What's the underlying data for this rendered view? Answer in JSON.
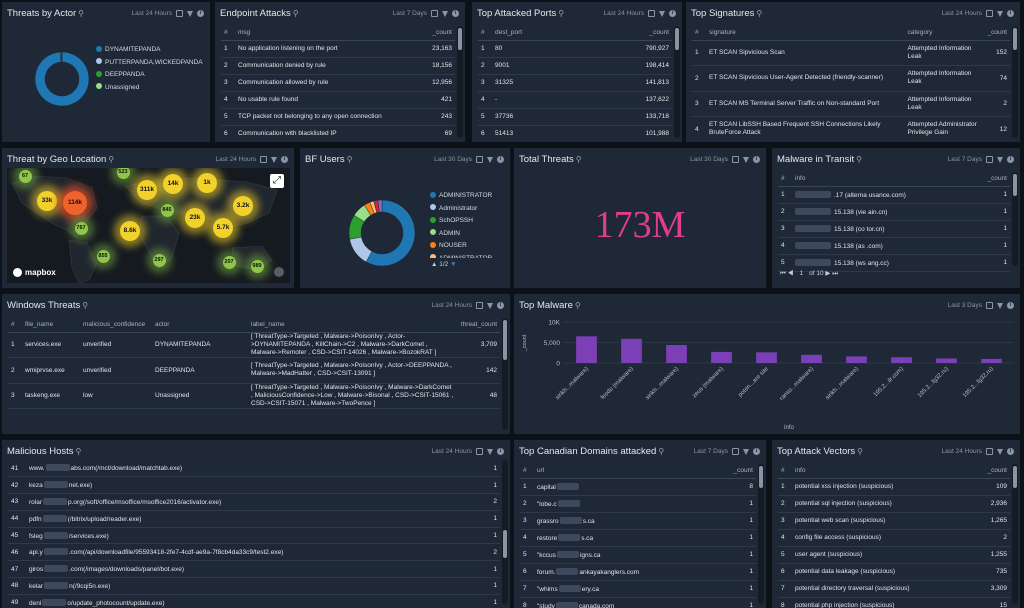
{
  "threats_by_actor": {
    "title": "Threats by Actor",
    "time": "Last 24 Hours",
    "legend": [
      {
        "label": "DYNAMITEPANDA",
        "color": "#1f77b4"
      },
      {
        "label": "PUTTERPANDA,WICKEDPANDA",
        "color": "#aec7e8"
      },
      {
        "label": "DEEPPANDA",
        "color": "#2ca02c"
      },
      {
        "label": "Unassigned",
        "color": "#98df8a"
      }
    ],
    "shares": [
      0.99,
      0.004,
      0.003,
      0.003
    ]
  },
  "endpoint_attacks": {
    "title": "Endpoint Attacks",
    "time": "Last 7 Days",
    "headers": [
      "#",
      "msg",
      "_count"
    ],
    "rows": [
      [
        "1",
        "No application listening on the port",
        "23,163"
      ],
      [
        "2",
        "Communication denied by rule",
        "18,156"
      ],
      [
        "3",
        "Communication allowed by rule",
        "12,956"
      ],
      [
        "4",
        "No usable rule found",
        "421"
      ],
      [
        "5",
        "TCP packet not belonging to any open connection",
        "243"
      ],
      [
        "6",
        "Communication with blacklisted IP",
        "69"
      ]
    ]
  },
  "top_attacked_ports": {
    "title": "Top Attacked Ports",
    "time": "Last 24 Hours",
    "headers": [
      "#",
      "dest_port",
      "_count"
    ],
    "rows": [
      [
        "1",
        "80",
        "790,927"
      ],
      [
        "2",
        "9001",
        "198,414"
      ],
      [
        "3",
        "31325",
        "141,813"
      ],
      [
        "4",
        "-",
        "137,622"
      ],
      [
        "5",
        "37736",
        "133,718"
      ],
      [
        "6",
        "51413",
        "101,988"
      ]
    ]
  },
  "top_signatures": {
    "title": "Top Signatures",
    "time": "Last 24 Hours",
    "headers": [
      "#",
      "signature",
      "category",
      "_count"
    ],
    "rows": [
      [
        "1",
        "ET SCAN Sipvicious Scan",
        "Attempted Information Leak",
        "152"
      ],
      [
        "2",
        "ET SCAN Sipvicious User-Agent Detected (friendly-scanner)",
        "Attempted Information Leak",
        "74"
      ],
      [
        "3",
        "ET SCAN MS Terminal Server Traffic on Non-standard Port",
        "Attempted Information Leak",
        "2"
      ],
      [
        "4",
        "ET SCAN LibSSH Based Frequent SSH Connections Likely BruteForce Attack",
        "Attempted Administrator Privilege Gain",
        "12"
      ]
    ]
  },
  "threat_geo": {
    "title": "Threat by Geo Location",
    "time": "Last 24 Hours",
    "attribution": "mapbox",
    "clusters": [
      {
        "label": "67",
        "level": 1
      },
      {
        "label": "523",
        "level": 1
      },
      {
        "label": "33k",
        "level": 2
      },
      {
        "label": "114k",
        "level": 3
      },
      {
        "label": "311k",
        "level": 2
      },
      {
        "label": "14k",
        "level": 2
      },
      {
        "label": "1k",
        "level": 2
      },
      {
        "label": "845",
        "level": 1
      },
      {
        "label": "3.2k",
        "level": 2
      },
      {
        "label": "8.6k",
        "level": 2
      },
      {
        "label": "23k",
        "level": 2
      },
      {
        "label": "5.7k",
        "level": 2
      },
      {
        "label": "767",
        "level": 1
      },
      {
        "label": "855",
        "level": 1
      },
      {
        "label": "297",
        "level": 1
      },
      {
        "label": "207",
        "level": 1
      },
      {
        "label": "989",
        "level": 1
      }
    ]
  },
  "bf_users": {
    "title": "BF Users",
    "time": "Last 30 Days",
    "legend": [
      {
        "label": "ADMINISTRATOR",
        "color": "#1f77b4"
      },
      {
        "label": "Administrator",
        "color": "#aec7e8"
      },
      {
        "label": "SchOPSSH",
        "color": "#2ca02c"
      },
      {
        "label": "ADMIN",
        "color": "#98df8a"
      },
      {
        "label": "NOUSER",
        "color": "#ff7f0e"
      },
      {
        "label": "ADMINISTRATOR",
        "color": "#ffbb78"
      }
    ],
    "shares": [
      0.58,
      0.14,
      0.12,
      0.07,
      0.03,
      0.02,
      0.02,
      0.02
    ],
    "extra_colors": [
      "#d62728",
      "#9467bd"
    ],
    "pager": "1/2"
  },
  "total_threats": {
    "title": "Total Threats",
    "time": "Last 30 Days",
    "value": "173M",
    "color": "#e23c8c"
  },
  "malware_transit": {
    "title": "Malware in Transit",
    "time": "Last 7 Days",
    "headers": [
      "#",
      "info",
      "_count"
    ],
    "rows": [
      [
        "1",
        ".17 (alterna    usance.com)",
        "1"
      ],
      [
        "2",
        "15.138 (vie    ain.cn)",
        "1"
      ],
      [
        "3",
        "15.138 (co    tor.cn)",
        "1"
      ],
      [
        "4",
        "15.138 (as    .com)",
        "1"
      ],
      [
        "5",
        "15.138 (ws    ang.cc)",
        "1"
      ]
    ],
    "pager": {
      "of": "of",
      "page": "1",
      "total": "10"
    }
  },
  "windows_threats": {
    "title": "Windows Threats",
    "time": "Last 24 Hours",
    "headers": [
      "#",
      "file_name",
      "malicious_confidence",
      "actor",
      "label_name",
      "threat_count"
    ],
    "rows": [
      [
        "1",
        "services.exe",
        "unverified",
        "DYNAMITEPANDA",
        "[ ThreatType->Targeted , Malware->PoisonIvy , Actor->DYNAMITEPANDA , KillChain->C2 , Malware->DarkComet , Malware->Remoter , CSD->CSIT-14026 , Malware->BozokRAT ]",
        "3,709"
      ],
      [
        "2",
        "wmiprvse.exe",
        "unverified",
        "DEEPPANDA",
        "[ ThreatType->Targeted , Malware->PoisonIvy , Actor->DEEPPANDA , Malware->MadHatter , CSD->CSIT-13091 ]",
        "142"
      ],
      [
        "3",
        "taskeng.exe",
        "low",
        "Unassigned",
        "[ ThreatType->Targeted , Malware->PoisonIvy , Malware->DarkComet , MaliciousConfidence->Low , Malware->Bisonal , CSD->CSIT-15061 , CSD->CSIT-15071 , Malware->TwoPence ]",
        "48"
      ]
    ]
  },
  "top_malware": {
    "title": "Top Malware",
    "time": "Last 3 Days",
    "color": "#7b3fb8"
  },
  "chart_data": {
    "type": "bar",
    "categories": [
      "sirikh...malware)",
      "feodo (malware)",
      "sirikh...malware)",
      "zeus (malware)",
      "poten...are site",
      "ranso...malware)",
      "sirikh...malware)",
      "195.2...ilr.com)",
      "195.2...fg32.ru)",
      "195.2...fg32.ru)"
    ],
    "values": [
      6500,
      5900,
      4400,
      2700,
      2600,
      2000,
      1600,
      1400,
      1100,
      1000
    ],
    "xlabel": "info",
    "ylabel": "_count",
    "ylim": [
      0,
      10000
    ],
    "yticks": [
      "10K",
      "5,000",
      "0"
    ]
  },
  "malicious_hosts": {
    "title": "Malicious Hosts",
    "time": "Last 24 Hours",
    "rows": [
      [
        "41",
        "www.",
        "abs.com(/mct/download/matchtab.exe)",
        "1"
      ],
      [
        "42",
        "keza",
        "net.exe)",
        "1"
      ],
      [
        "43",
        "rolar",
        "p.org(/soft/office/msoffice/msoffice2016/activator.exe)",
        "2"
      ],
      [
        "44",
        "pdfn",
        "(/bitrix/upload/reader.exe)",
        "1"
      ],
      [
        "45",
        "fsleg",
        "/services.exe)",
        "1"
      ],
      [
        "46",
        "api.y",
        ".com(/api/downloadfile/95593418-2fe7-4cdf-ae9a-7f8cb4da33c9/test2.exe)",
        "2"
      ],
      [
        "47",
        "giros",
        ".com(/images/downloads/panel/bot.exe)",
        "1"
      ],
      [
        "48",
        "kelar",
        "n(/9cqi5n.exe)",
        "1"
      ],
      [
        "49",
        "deni",
        "o/update_photocount/update.exe)",
        "1"
      ]
    ]
  },
  "canadian_domains": {
    "title": "Top Canadian Domains attacked",
    "time": "Last 7 Days",
    "headers": [
      "#",
      "url",
      "_count"
    ],
    "rows": [
      [
        "1",
        "capital",
        "",
        "8"
      ],
      [
        "2",
        "\"lobe.c",
        "",
        "1"
      ],
      [
        "3",
        "grassro",
        "s.ca",
        "1"
      ],
      [
        "4",
        "restore",
        "s.ca",
        "1"
      ],
      [
        "5",
        "\"kccus",
        "igns.ca",
        "1"
      ],
      [
        "6",
        "forum.",
        "ankayakanglers.com",
        "1"
      ],
      [
        "7",
        "\"whims",
        "ery.ca",
        "1"
      ],
      [
        "8",
        "\"study",
        "canada.com",
        "1"
      ]
    ]
  },
  "attack_vectors": {
    "title": "Top Attack Vectors",
    "time": "Last 24 Hours",
    "headers": [
      "#",
      "info",
      "_count"
    ],
    "rows": [
      [
        "1",
        "potential xss injection (suspicious)",
        "109"
      ],
      [
        "2",
        "potential sql injection (suspicious)",
        "2,936"
      ],
      [
        "3",
        "potential web scan (suspicious)",
        "1,265"
      ],
      [
        "4",
        "config file access (suspicious)",
        "2"
      ],
      [
        "5",
        "user agent (suspicious)",
        "1,255"
      ],
      [
        "6",
        "potential data leakage (suspicious)",
        "735"
      ],
      [
        "7",
        "potential directory traversal (suspicious)",
        "3,309"
      ],
      [
        "8",
        "potential php injection (suspicious)",
        "15"
      ]
    ]
  }
}
